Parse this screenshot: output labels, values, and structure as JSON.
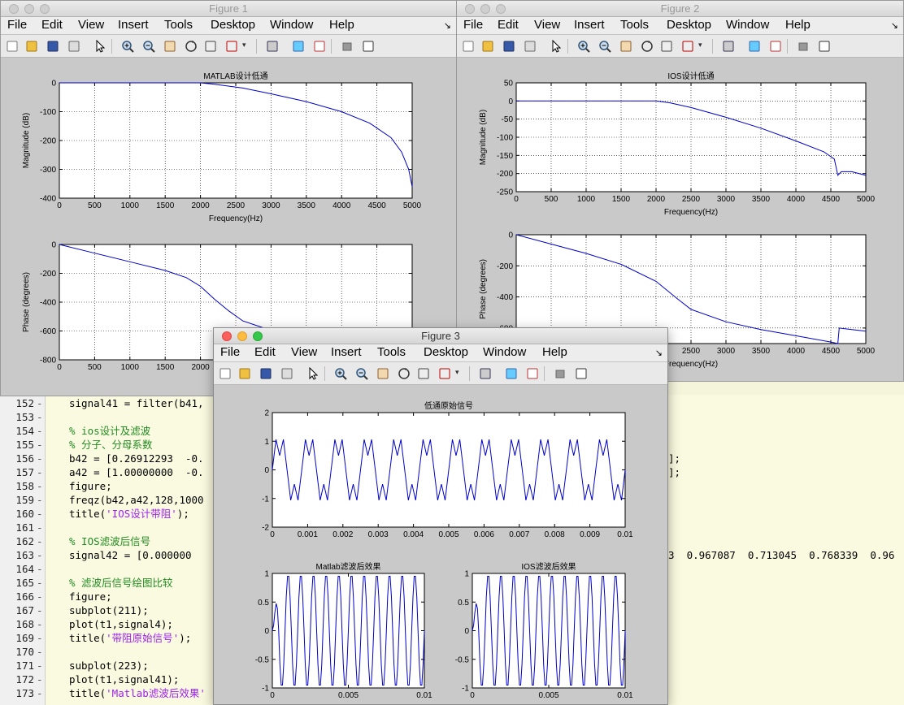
{
  "menus": [
    "File",
    "Edit",
    "View",
    "Insert",
    "Tools",
    "Desktop",
    "Window",
    "Help"
  ],
  "figures": [
    {
      "id": "fig1",
      "title": "Figure 1"
    },
    {
      "id": "fig2",
      "title": "Figure 2"
    },
    {
      "id": "fig3",
      "title": "Figure 3"
    }
  ],
  "editor_lines": [
    {
      "n": "152",
      "code": "signal41 = filter(b41,",
      "kind": "code",
      "tail": ""
    },
    {
      "n": "153",
      "code": "",
      "kind": "code",
      "tail": ""
    },
    {
      "n": "154",
      "code": "% ios设计及滤波",
      "kind": "cmt",
      "tail": ""
    },
    {
      "n": "155",
      "code": "% 分子、分母系数",
      "kind": "cmt",
      "tail": ""
    },
    {
      "n": "156",
      "code": "b42 = [0.26912293  -0.",
      "kind": "code",
      "tail": "];"
    },
    {
      "n": "157",
      "code": "a42 = [1.00000000  -0.",
      "kind": "code",
      "tail": "];"
    },
    {
      "n": "158",
      "code": "figure;",
      "kind": "code",
      "tail": ""
    },
    {
      "n": "159",
      "code": "freqz(b42,a42,128,1000",
      "kind": "code",
      "tail": ""
    },
    {
      "n": "160",
      "code": "title('IOS设计带阻');",
      "kind": "str",
      "tail": ""
    },
    {
      "n": "161",
      "code": "",
      "kind": "code",
      "tail": ""
    },
    {
      "n": "162",
      "code": "% IOS滤波后信号",
      "kind": "cmt",
      "tail": ""
    },
    {
      "n": "163",
      "code": "signal42 = [0.000000  ",
      "kind": "code",
      "tail": "3  0.967087  0.713045  0.768339  0.96"
    },
    {
      "n": "164",
      "code": "",
      "kind": "code",
      "tail": ""
    },
    {
      "n": "165",
      "code": "% 滤波后信号绘图比较",
      "kind": "cmt",
      "tail": ""
    },
    {
      "n": "166",
      "code": "figure;",
      "kind": "code",
      "tail": ""
    },
    {
      "n": "167",
      "code": "subplot(211);",
      "kind": "code",
      "tail": ""
    },
    {
      "n": "168",
      "code": "plot(t1,signal4);",
      "kind": "code",
      "tail": ""
    },
    {
      "n": "169",
      "code": "title('带阻原始信号');",
      "kind": "str",
      "tail": ""
    },
    {
      "n": "170",
      "code": "",
      "kind": "code",
      "tail": ""
    },
    {
      "n": "171",
      "code": "subplot(223);",
      "kind": "code",
      "tail": ""
    },
    {
      "n": "172",
      "code": "plot(t1,signal41);",
      "kind": "code",
      "tail": ""
    },
    {
      "n": "173",
      "code": "title('Matlab滤波后效果'",
      "kind": "str",
      "tail": ""
    }
  ],
  "chart_data": [
    {
      "id": "f1_mag",
      "type": "line",
      "title": "MATLAB设计低通",
      "xlabel": "Frequency(Hz)",
      "ylabel": "Magnitude (dB)",
      "xlim": [
        0,
        5000
      ],
      "ylim": [
        -400,
        0
      ],
      "xticks": [
        0,
        500,
        1000,
        1500,
        2000,
        2500,
        3000,
        3500,
        4000,
        4500,
        5000
      ],
      "yticks": [
        -400,
        -300,
        -200,
        -100,
        0
      ],
      "grid": true,
      "x": [
        0,
        2000,
        2200,
        2600,
        3000,
        3500,
        4000,
        4400,
        4700,
        4850,
        4950,
        5000
      ],
      "y": [
        0,
        0,
        -5,
        -18,
        -38,
        -65,
        -100,
        -140,
        -190,
        -240,
        -300,
        -360
      ]
    },
    {
      "id": "f1_phase",
      "type": "line",
      "title": "",
      "xlabel": "",
      "ylabel": "Phase (degrees)",
      "xlim": [
        0,
        5000
      ],
      "ylim": [
        -800,
        0
      ],
      "xticks": [
        0,
        500,
        1000,
        1500,
        2000,
        2500,
        3000,
        3500,
        4000,
        4500,
        5000
      ],
      "yticks": [
        -800,
        -600,
        -400,
        -200,
        0
      ],
      "grid": true,
      "x": [
        0,
        500,
        1000,
        1500,
        1800,
        2000,
        2200,
        2400,
        2600,
        2900
      ],
      "y": [
        0,
        -60,
        -120,
        -180,
        -230,
        -290,
        -380,
        -460,
        -530,
        -580
      ]
    },
    {
      "id": "f2_mag",
      "type": "line",
      "title": "IOS设计低通",
      "xlabel": "Frequency(Hz)",
      "ylabel": "Magnitude (dB)",
      "xlim": [
        0,
        5000
      ],
      "ylim": [
        -250,
        50
      ],
      "xticks": [
        0,
        500,
        1000,
        1500,
        2000,
        2500,
        3000,
        3500,
        4000,
        4500,
        5000
      ],
      "yticks": [
        -250,
        -200,
        -150,
        -100,
        -50,
        0,
        50
      ],
      "grid": true,
      "x": [
        0,
        1500,
        2000,
        2200,
        2500,
        3000,
        3500,
        4000,
        4400,
        4550,
        4600,
        4650,
        4800,
        5000
      ],
      "y": [
        0,
        0,
        0,
        -5,
        -18,
        -45,
        -75,
        -110,
        -140,
        -160,
        -205,
        -195,
        -195,
        -205
      ]
    },
    {
      "id": "f2_phase",
      "type": "line",
      "title": "",
      "xlabel": "Frequency(Hz)",
      "ylabel": "Phase (degrees)",
      "xlim": [
        0,
        5000
      ],
      "ylim": [
        -700,
        0
      ],
      "xticks": [
        0,
        500,
        1000,
        1500,
        2000,
        2500,
        3000,
        3500,
        4000,
        4500,
        5000
      ],
      "yticks": [
        -600,
        -400,
        -200,
        0
      ],
      "grid": true,
      "x": [
        0,
        500,
        1000,
        1500,
        2000,
        2300,
        2500,
        3000,
        3500,
        4000,
        4500,
        4600,
        4620,
        4800,
        5000
      ],
      "y": [
        0,
        -60,
        -120,
        -190,
        -300,
        -410,
        -480,
        -560,
        -610,
        -650,
        -690,
        -700,
        -600,
        -610,
        -620
      ]
    },
    {
      "id": "f3_orig",
      "type": "line",
      "title": "低通原始信号",
      "xlabel": "",
      "ylabel": "",
      "xlim": [
        0,
        0.01
      ],
      "ylim": [
        -2,
        2
      ],
      "xticks": [
        0,
        0.001,
        0.002,
        0.003,
        0.004,
        0.005,
        0.006,
        0.007,
        0.008,
        0.009,
        0.01
      ],
      "yticks": [
        -2,
        -1,
        0,
        1,
        2
      ],
      "grid": false,
      "cycles": 12
    },
    {
      "id": "f3_matlab",
      "type": "line",
      "title": "Matlab滤波后效果",
      "xlabel": "",
      "ylabel": "",
      "xlim": [
        0,
        0.01
      ],
      "ylim": [
        -1,
        1
      ],
      "xticks": [
        0,
        0.005,
        0.01
      ],
      "yticks": [
        -1,
        -0.5,
        0,
        0.5,
        1
      ],
      "grid": false,
      "cycles": 12
    },
    {
      "id": "f3_ios",
      "type": "line",
      "title": "IOS滤波后效果",
      "xlabel": "",
      "ylabel": "",
      "xlim": [
        0,
        0.01
      ],
      "ylim": [
        -1,
        1
      ],
      "xticks": [
        0,
        0.005,
        0.01
      ],
      "yticks": [
        -1,
        -0.5,
        0,
        0.5,
        1
      ],
      "grid": false,
      "cycles": 12
    }
  ]
}
